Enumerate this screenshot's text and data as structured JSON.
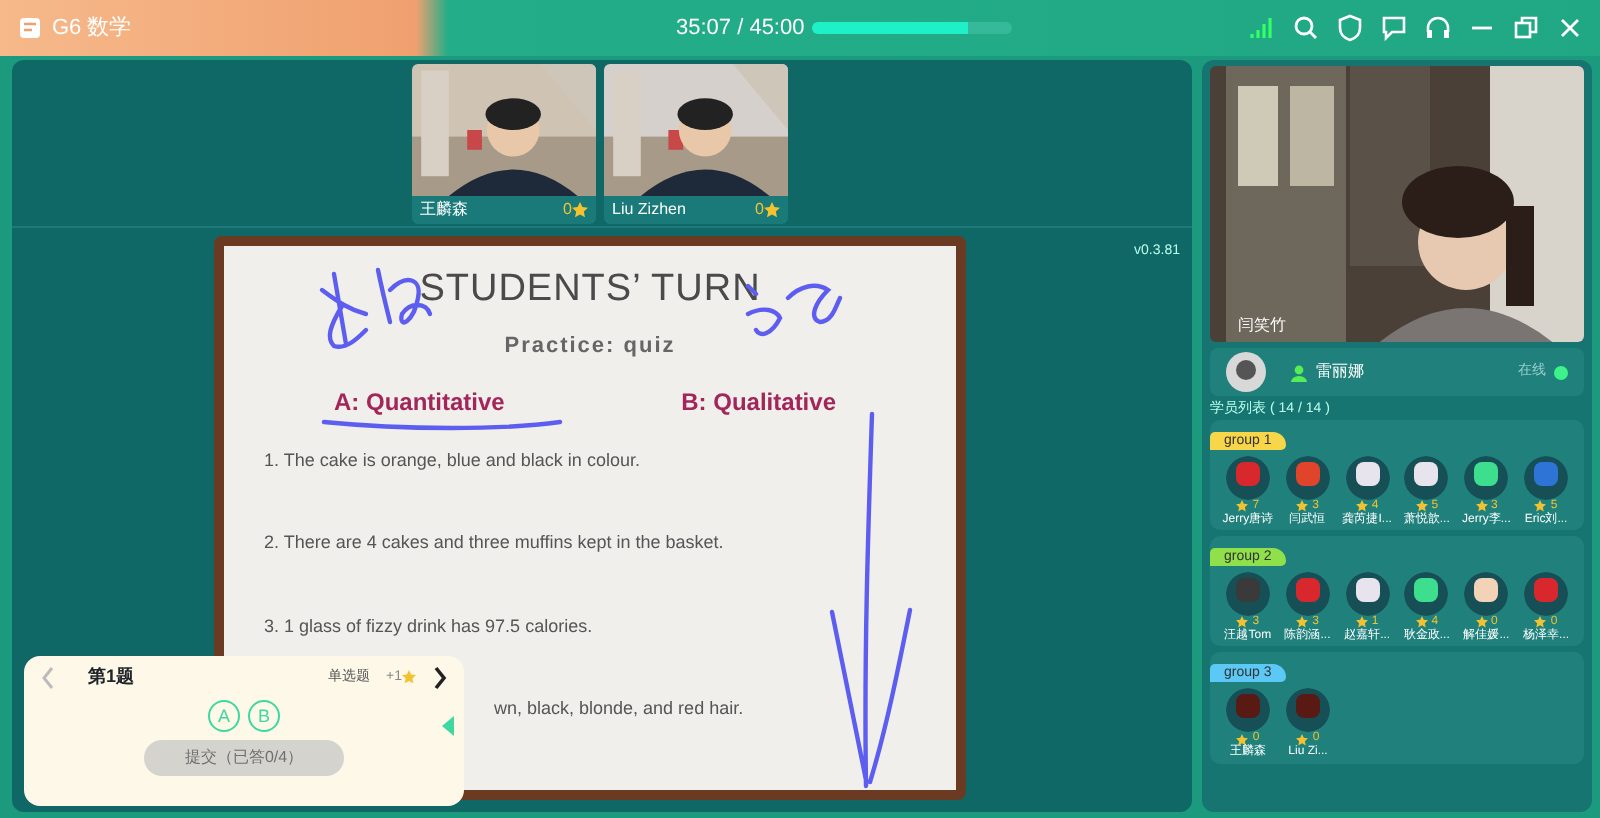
{
  "app": {
    "title": "G6 数学",
    "timer": "35:07 / 45:00",
    "progress": {
      "level": 0.78
    }
  },
  "students_video": [
    {
      "name": "王麟森",
      "score": "0"
    },
    {
      "name": "Liu Zizhen",
      "score": "0"
    }
  ],
  "version": "v0.3.81",
  "slide": {
    "title": "STUDENTS’ TURN",
    "subtitle": "Practice: quiz",
    "options": [
      "A: Quantitative",
      "B: Qualitative"
    ],
    "items": [
      "1. The cake is orange, blue and black in colour.",
      "2. There are 4 cakes and three muffins kept in the basket.",
      "3. 1 glass of fizzy drink has 97.5 calories.",
      "wn, black, blonde, and red hair."
    ]
  },
  "quiz": {
    "title": "第1题",
    "type": "单选题",
    "reward": "+1",
    "choices": [
      {
        "label": "A",
        "selected": false
      },
      {
        "label": "B",
        "selected": false
      }
    ],
    "submit": {
      "label": "提交（已答0/4）",
      "disabled": true
    }
  },
  "teacher": {
    "name": "闫笑竹"
  },
  "assistant": {
    "name": "雷丽娜",
    "status": "在线"
  },
  "roster_label": "学员列表 ( 14 / 14 )",
  "groups": [
    {
      "name": "group 1",
      "color": "#f7d64a",
      "members": [
        {
          "name": "Jerry唐诗",
          "stars": "7",
          "color": "#d8282d"
        },
        {
          "name": "闫武恒",
          "stars": "3",
          "color": "#e0452b"
        },
        {
          "name": "龚芮捷I...",
          "stars": "4",
          "color": "#e8e4ee"
        },
        {
          "name": "萧悦歆...",
          "stars": "5",
          "color": "#e8e4ee"
        },
        {
          "name": "Jerry李...",
          "stars": "3",
          "color": "#3ddf8f"
        },
        {
          "name": "Eric刘...",
          "stars": "5",
          "color": "#2e74d6"
        }
      ]
    },
    {
      "name": "group 2",
      "color": "#8fe04a",
      "members": [
        {
          "name": "汪越Tom",
          "stars": "3",
          "color": "#3a3a3a"
        },
        {
          "name": "陈韵涵...",
          "stars": "3",
          "color": "#d8282d"
        },
        {
          "name": "赵嘉轩...",
          "stars": "1",
          "color": "#e8e4ee"
        },
        {
          "name": "耿金政...",
          "stars": "4",
          "color": "#3ddf8f"
        },
        {
          "name": "解佳媛...",
          "stars": "0",
          "color": "#f2d3b8"
        },
        {
          "name": "杨泽幸...",
          "stars": "0",
          "color": "#d8282d"
        }
      ]
    },
    {
      "name": "group 3",
      "color": "#5cc8f5",
      "members": [
        {
          "name": "王麟森",
          "stars": "0",
          "color": "#5a1a14"
        },
        {
          "name": "Liu Zi...",
          "stars": "0",
          "color": "#5a1a14"
        }
      ]
    }
  ]
}
